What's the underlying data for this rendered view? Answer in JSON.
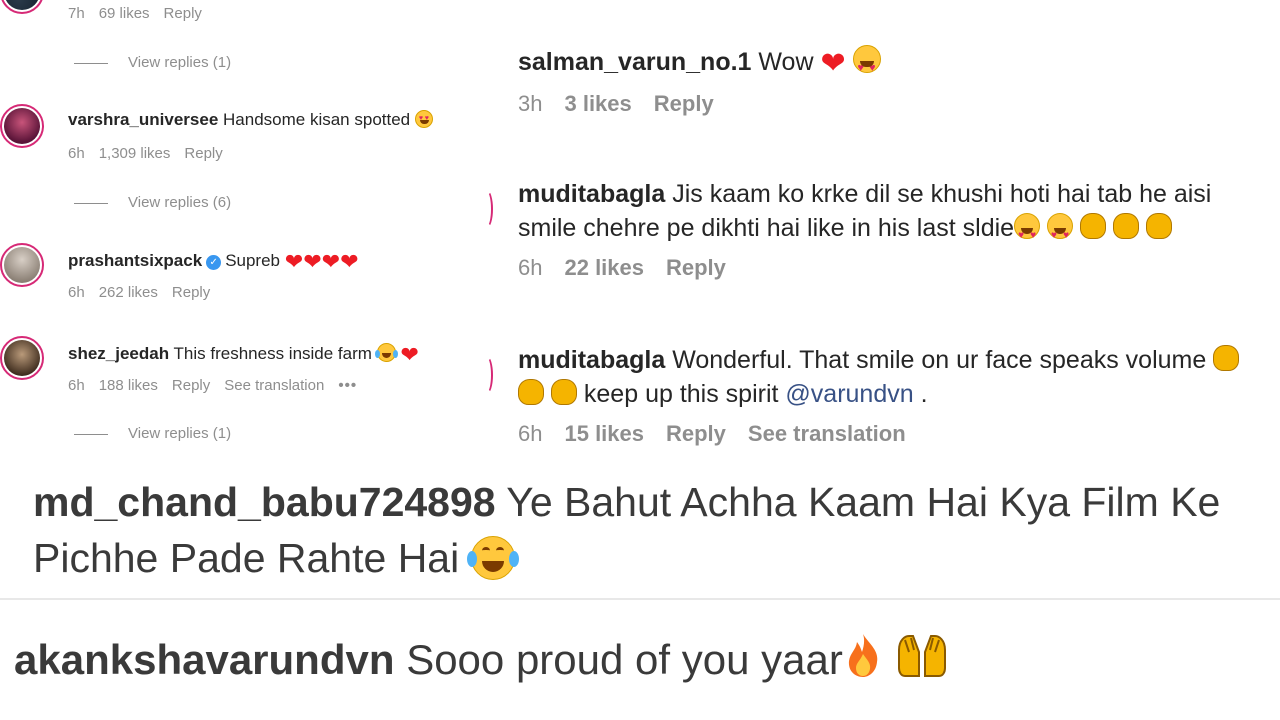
{
  "left_panel": {
    "comments": [
      {
        "meta": {
          "time": "7h",
          "likes": "69 likes",
          "reply": "Reply"
        },
        "view_replies": "View replies (1)"
      },
      {
        "username": "varshra_universee",
        "text": "Handsome kisan spotted",
        "emojis": [
          "heart-eyes-emoji"
        ],
        "meta": {
          "time": "6h",
          "likes": "1,309 likes",
          "reply": "Reply"
        },
        "view_replies": "View replies (6)"
      },
      {
        "username": "prashantsixpack",
        "verified": true,
        "text": "Supreb",
        "emojis": [
          "red-heart-emoji",
          "red-heart-emoji",
          "red-heart-emoji",
          "red-heart-emoji"
        ],
        "meta": {
          "time": "6h",
          "likes": "262 likes",
          "reply": "Reply"
        }
      },
      {
        "username": "shez_jeedah",
        "text": "This freshness inside farm",
        "emojis": [
          "laughing-tears-emoji",
          "red-heart-emoji"
        ],
        "meta": {
          "time": "6h",
          "likes": "188 likes",
          "reply": "Reply",
          "translation": "See translation",
          "more": "•••"
        },
        "view_replies": "View replies (1)"
      }
    ]
  },
  "right_panel": {
    "comments": [
      {
        "username": "salman_varun_no.1",
        "text": "Wow",
        "emojis": [
          "red-heart-emoji",
          "heart-eyes-emoji"
        ],
        "meta": {
          "time": "3h",
          "likes": "3 likes",
          "reply": "Reply"
        }
      },
      {
        "username": "muditabagla",
        "text": "Jis kaam ko krke dil se khushi hoti hai tab he aisi smile chehre pe dikhti hai like in his last sldie",
        "emojis": [
          "heart-eyes-emoji",
          "heart-eyes-emoji",
          "clapping-hands-emoji",
          "clapping-hands-emoji",
          "clapping-hands-emoji"
        ],
        "meta": {
          "time": "6h",
          "likes": "22 likes",
          "reply": "Reply"
        }
      },
      {
        "username": "muditabagla",
        "text_before": "Wonderful. That smile on ur face speaks volume",
        "emojis": [
          "clapping-hands-emoji",
          "clapping-hands-emoji",
          "clapping-hands-emoji"
        ],
        "text_after": "keep up this spirit",
        "mention": "@varundvn",
        "text_end": ".",
        "meta": {
          "time": "6h",
          "likes": "15 likes",
          "reply": "Reply",
          "translation": "See translation"
        }
      }
    ]
  },
  "bottom_comments": [
    {
      "username": "md_chand_babu724898",
      "text": "Ye Bahut Achha Kaam Hai Kya Film Ke Pichhe Pade Rahte Hai",
      "emojis": [
        "laughing-tears-emoji"
      ]
    },
    {
      "username": "akankshavarundvn",
      "text": "Sooo proud of you yaar",
      "emojis": [
        "fire-emoji",
        "raising-hands-emoji"
      ]
    }
  ],
  "colors": {
    "username": "#262626",
    "meta_text": "#8e8e8e",
    "mention": "#385185",
    "story_ring": "#d62976",
    "verified": "#3897f0",
    "heart": "#ed1c24"
  }
}
